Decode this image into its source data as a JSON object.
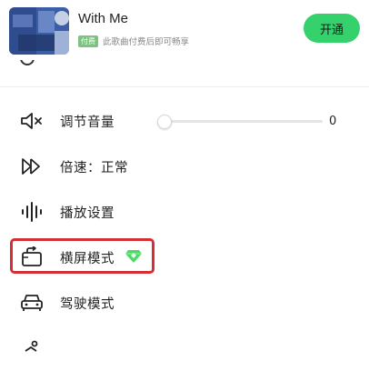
{
  "colors": {
    "accent_green": "#34d16c",
    "paid_badge": "#7bc37f",
    "highlight_red": "#d32f34",
    "vip_diamond": "#4cd964"
  },
  "header": {
    "song_title": "With Me",
    "paid_badge": "付费",
    "paid_note": "此歌曲付费后即可畅享",
    "open_button": "开通"
  },
  "menu": {
    "volume": {
      "label": "调节音量",
      "value": "0",
      "level": 0
    },
    "speed": {
      "label": "倍速：正常"
    },
    "playback_settings": {
      "label": "播放设置"
    },
    "landscape_mode": {
      "label": "横屏模式",
      "vip_icon": "diamond-icon"
    },
    "driving_mode": {
      "label": "驾驶模式"
    }
  }
}
